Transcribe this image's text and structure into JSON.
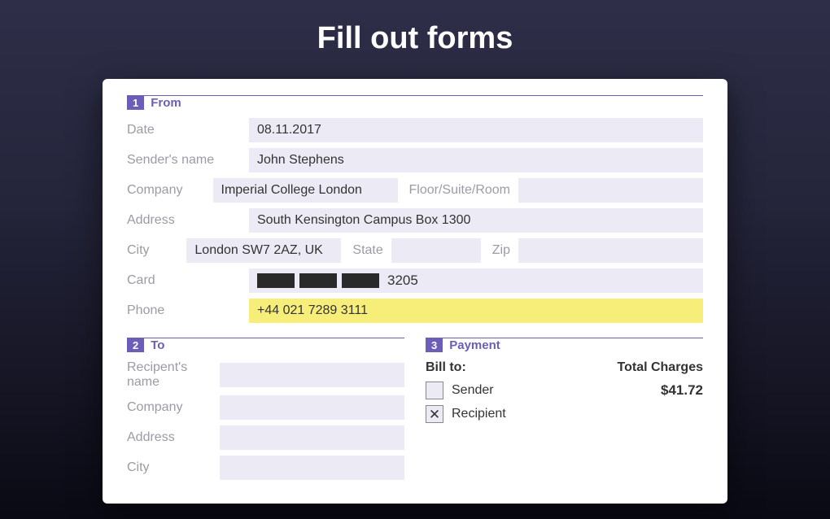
{
  "heading": "Fill out forms",
  "colors": {
    "accent": "#6b5db8",
    "highlight": "#f7ee7a"
  },
  "from": {
    "badge": "1",
    "title": "From",
    "labels": {
      "date": "Date",
      "sender": "Sender's name",
      "company": "Company",
      "floor": "Floor/Suite/Room",
      "address": "Address",
      "city": "City",
      "state": "State",
      "zip": "Zip",
      "card": "Card",
      "phone": "Phone"
    },
    "values": {
      "date": "08.11.2017",
      "sender": "John Stephens",
      "company": "Imperial College London",
      "floor": "",
      "address": "South Kensington Campus Box 1300",
      "city": "London SW7 2AZ, UK",
      "state": "",
      "zip": "",
      "card_last": "3205",
      "phone": "+44 021 7289 3111"
    }
  },
  "to": {
    "badge": "2",
    "title": "To",
    "labels": {
      "recipient": "Recipent's name",
      "company": "Company",
      "address": "Address",
      "city": "City"
    },
    "values": {
      "recipient": "",
      "company": "",
      "address": "",
      "city": ""
    }
  },
  "payment": {
    "badge": "3",
    "title": "Payment",
    "billto_label": "Bill to:",
    "total_label": "Total Charges",
    "sender_label": "Sender",
    "recipient_label": "Recipient",
    "sender_checked": false,
    "recipient_checked": true,
    "amount": "$41.72"
  }
}
